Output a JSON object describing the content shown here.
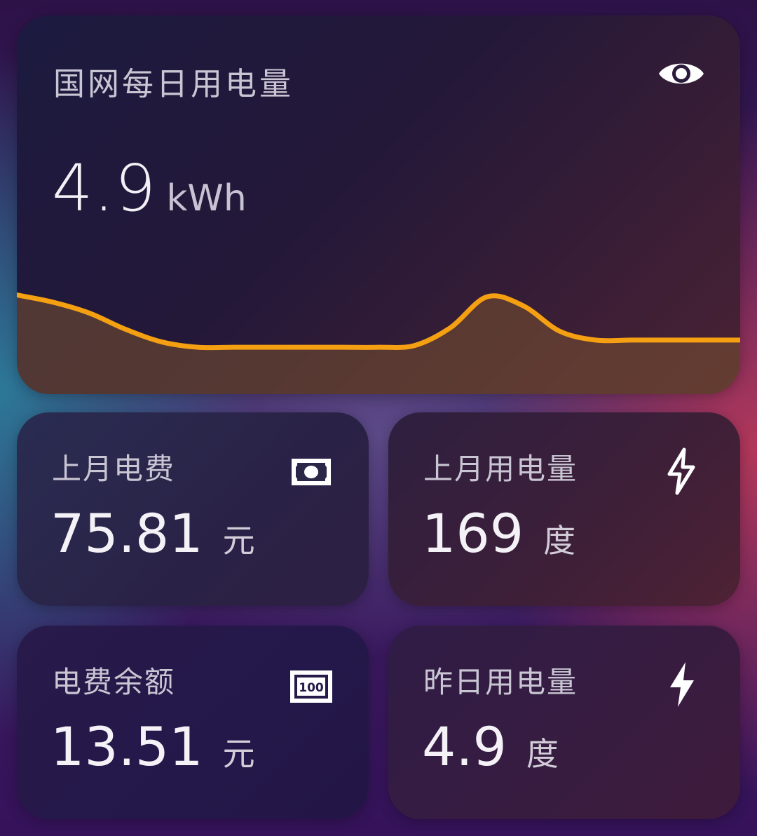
{
  "main": {
    "title": "国网每日用电量",
    "value": "4.9",
    "unit": "kWh",
    "icon": "eye-icon"
  },
  "chart_data": {
    "type": "area",
    "x": [
      0,
      1,
      2,
      3,
      4,
      5,
      6,
      7,
      8,
      9,
      10,
      11,
      12,
      13,
      14,
      15,
      16,
      17,
      18,
      19,
      20
    ],
    "values": [
      5.5,
      5.1,
      4.5,
      3.6,
      2.9,
      2.6,
      2.6,
      2.6,
      2.6,
      2.6,
      2.6,
      2.7,
      3.7,
      5.4,
      4.9,
      3.5,
      3.0,
      3.0,
      3.0,
      3.0,
      3.0
    ],
    "ylim": [
      0,
      7
    ],
    "colors": {
      "line": "#f4a012",
      "fill": "#7a5230"
    }
  },
  "cards": [
    {
      "label": "上月电费",
      "value": "75.81",
      "unit": "元",
      "icon": "cash-icon"
    },
    {
      "label": "上月用电量",
      "value": "169",
      "unit": "度",
      "icon": "lightning-bolt-outline-icon"
    },
    {
      "label": "电费余额",
      "value": "13.51",
      "unit": "元",
      "icon": "bill-100-icon",
      "icon_text": "100"
    },
    {
      "label": "昨日用电量",
      "value": "4.9",
      "unit": "度",
      "icon": "lightning-bolt-icon"
    }
  ]
}
